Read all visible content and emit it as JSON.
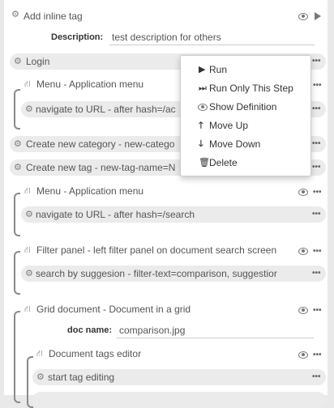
{
  "rows": {
    "add_inline_tag": "Add inline tag",
    "description_label": "Description:",
    "description_value": "test description for others",
    "login": "Login",
    "menu_app_1": "Menu - Application menu",
    "nav_url_1": "navigate to URL - after hash=/ac",
    "create_category": "Create new category - new-catego",
    "create_tag": "Create new tag - new-tag-name=N",
    "menu_app_2": "Menu - Application menu",
    "nav_url_2": "navigate to URL - after hash=/search",
    "filter_panel": "Filter panel - left filter panel on document search screen",
    "search_suggestion": "search by suggesion - filter-text=comparison, suggestior",
    "grid_document": "Grid document - Document in a grid",
    "doc_name_label": "doc name:",
    "doc_name_value": "comparison.jpg",
    "doc_tags_editor": "Document tags editor",
    "start_tag_editing": "start tag editing"
  },
  "context_menu": {
    "run": "Run",
    "run_only_step": "Run Only This Step",
    "show_definition": "Show Definition",
    "move_up": "Move Up",
    "move_down": "Move Down",
    "delete": "Delete"
  },
  "more_glyph": "•••",
  "icons": {
    "step": "gears-icon",
    "component": "sitemap-icon",
    "visible": "eye-icon",
    "run": "play-icon",
    "more": "ellipsis-icon"
  }
}
